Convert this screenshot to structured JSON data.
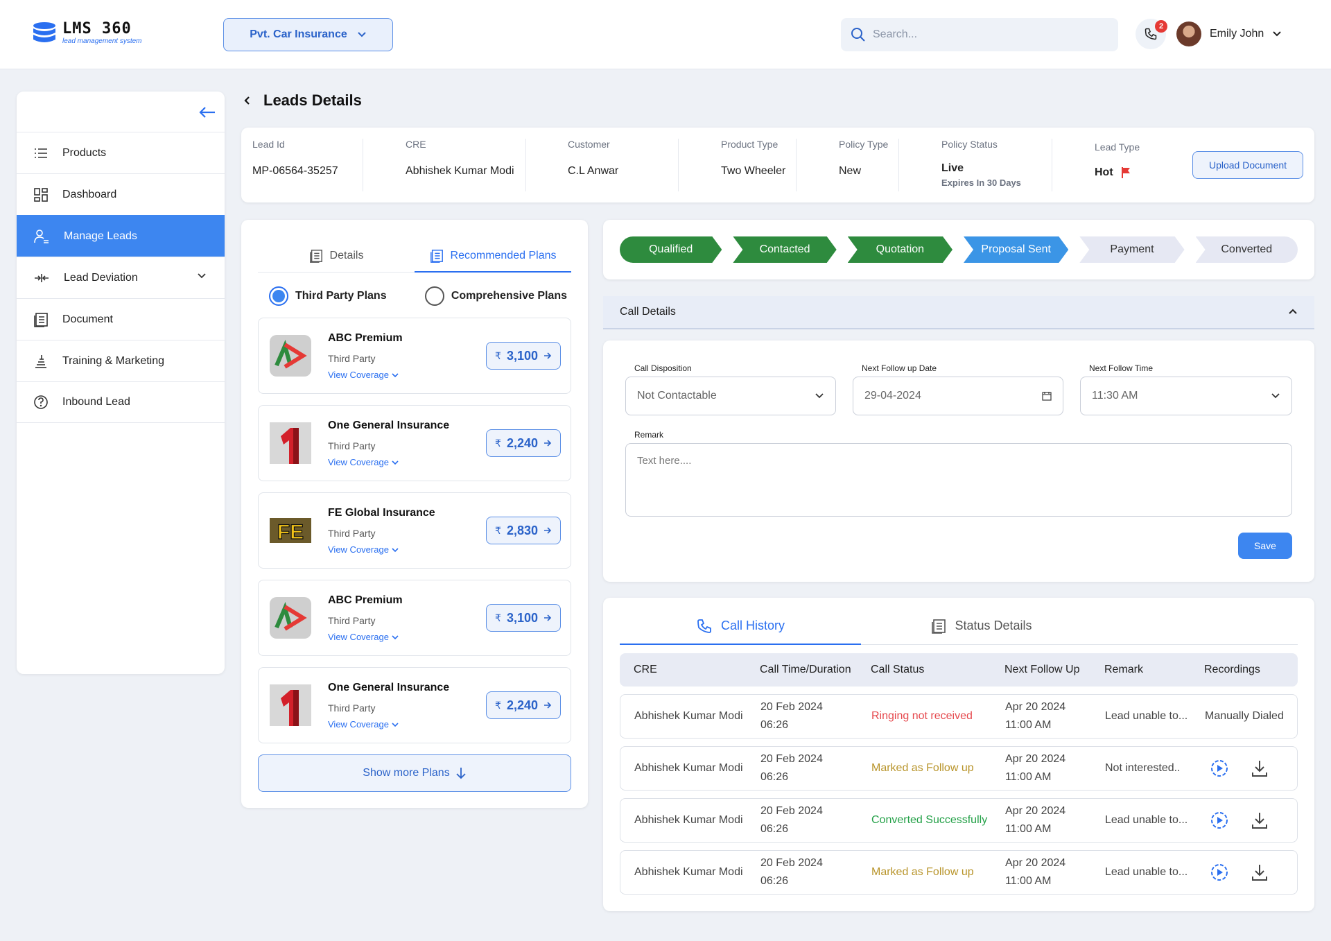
{
  "app": {
    "logo_name": "LMS 360",
    "logo_sub": "lead management system"
  },
  "header": {
    "product": "Pvt. Car Insurance",
    "search_placeholder": "Search...",
    "notif_count": "2",
    "user_name": "Emily John"
  },
  "sidebar": {
    "items": [
      {
        "label": "Products",
        "icon": "list-icon"
      },
      {
        "label": "Dashboard",
        "icon": "dashboard-icon"
      },
      {
        "label": "Manage Leads",
        "icon": "user-manage-icon",
        "active": true
      },
      {
        "label": "Lead Deviation",
        "icon": "deviation-icon"
      },
      {
        "label": "Document",
        "icon": "document-icon"
      },
      {
        "label": "Training & Marketing",
        "icon": "training-icon"
      },
      {
        "label": "Inbound Lead",
        "icon": "help-icon"
      }
    ]
  },
  "page": {
    "title": "Leads Details"
  },
  "lead": {
    "lead_id": {
      "label": "Lead Id",
      "value": "MP-06564-35257"
    },
    "cre": {
      "label": "CRE",
      "value": "Abhishek Kumar Modi"
    },
    "customer": {
      "label": "Customer",
      "value": "C.L Anwar"
    },
    "product_type": {
      "label": "Product Type",
      "value": "Two Wheeler"
    },
    "policy_type": {
      "label": "Policy Type",
      "value": "New"
    },
    "policy_status": {
      "label": "Policy Status",
      "value": "Live",
      "note": "Expires In 30 Days"
    },
    "lead_type": {
      "label": "Lead Type",
      "value": "Hot"
    },
    "upload_label": "Upload Document"
  },
  "plans": {
    "tabs": [
      "Details",
      "Recommended Plans"
    ],
    "radio_third": "Third Party Plans",
    "radio_comp": "Comprehensive Plans",
    "coverage_label": "View Coverage",
    "rupee": "₹",
    "items": [
      {
        "name": "ABC Premium",
        "type": "Third Party",
        "price": "3,100",
        "logo": "abc"
      },
      {
        "name": "One General Insurance",
        "type": "Third Party",
        "price": "2,240",
        "logo": "one"
      },
      {
        "name": "FE Global Insurance",
        "type": "Third Party",
        "price": "2,830",
        "logo": "fe",
        "logo_text": "FE"
      },
      {
        "name": "ABC Premium",
        "type": "Third Party",
        "price": "3,100",
        "logo": "abc"
      },
      {
        "name": "One General Insurance",
        "type": "Third Party",
        "price": "2,240",
        "logo": "one"
      }
    ],
    "show_more": "Show more Plans"
  },
  "stepper": {
    "steps": [
      {
        "label": "Qualified",
        "state": "done"
      },
      {
        "label": "Contacted",
        "state": "done"
      },
      {
        "label": "Quotation",
        "state": "done"
      },
      {
        "label": "Proposal Sent",
        "state": "current"
      },
      {
        "label": "Payment",
        "state": "pending"
      },
      {
        "label": "Converted",
        "state": "pending"
      }
    ],
    "colors": {
      "done": "#2e8b3e",
      "current": "#3b95e6",
      "pending": "#e6e8f3"
    }
  },
  "call": {
    "section_title": "Call Details",
    "disposition_label": "Call Disposition",
    "disposition_value": "Not Contactable",
    "followup_date_label": "Next Follow up Date",
    "followup_date_value": "29-04-2024",
    "followup_time_label": "Next Follow Time",
    "followup_time_value": "11:30 AM",
    "remark_label": "Remark",
    "remark_placeholder": "Text here....",
    "save_label": "Save"
  },
  "history": {
    "tabs": [
      "Call History",
      "Status Details"
    ],
    "columns": [
      "CRE",
      "Call Time/Duration",
      "Call Status",
      "Next Follow Up",
      "Remark",
      "Recordings"
    ],
    "rows": [
      {
        "cre": "Abhishek Kumar Modi",
        "date": "20 Feb 2024",
        "duration": "06:26",
        "status": "Ringing not received",
        "status_kind": "red",
        "follow_date": "Apr 20 2024",
        "follow_time": "11:00 AM",
        "remark": "Lead unable to...",
        "recording": "Manually Dialed"
      },
      {
        "cre": "Abhishek Kumar Modi",
        "date": "20 Feb 2024",
        "duration": "06:26",
        "status": "Marked as Follow up",
        "status_kind": "amber",
        "follow_date": "Apr 20 2024",
        "follow_time": "11:00 AM",
        "remark": "Not interested..",
        "recording": ""
      },
      {
        "cre": "Abhishek Kumar Modi",
        "date": "20 Feb 2024",
        "duration": "06:26",
        "status": "Converted Successfully",
        "status_kind": "green",
        "follow_date": "Apr 20 2024",
        "follow_time": "11:00 AM",
        "remark": "Lead unable to...",
        "recording": ""
      },
      {
        "cre": "Abhishek Kumar Modi",
        "date": "20 Feb 2024",
        "duration": "06:26",
        "status": "Marked as Follow up",
        "status_kind": "amber",
        "follow_date": "Apr 20 2024",
        "follow_time": "11:00 AM",
        "remark": "Lead unable to...",
        "recording": ""
      }
    ],
    "status_colors": {
      "red": "#e5484d",
      "amber": "#b8942a",
      "green": "#23a047"
    }
  },
  "theme": {
    "primary": "#3d86f0",
    "accent_text": "#2a62c9",
    "background": "#eef1f6"
  }
}
